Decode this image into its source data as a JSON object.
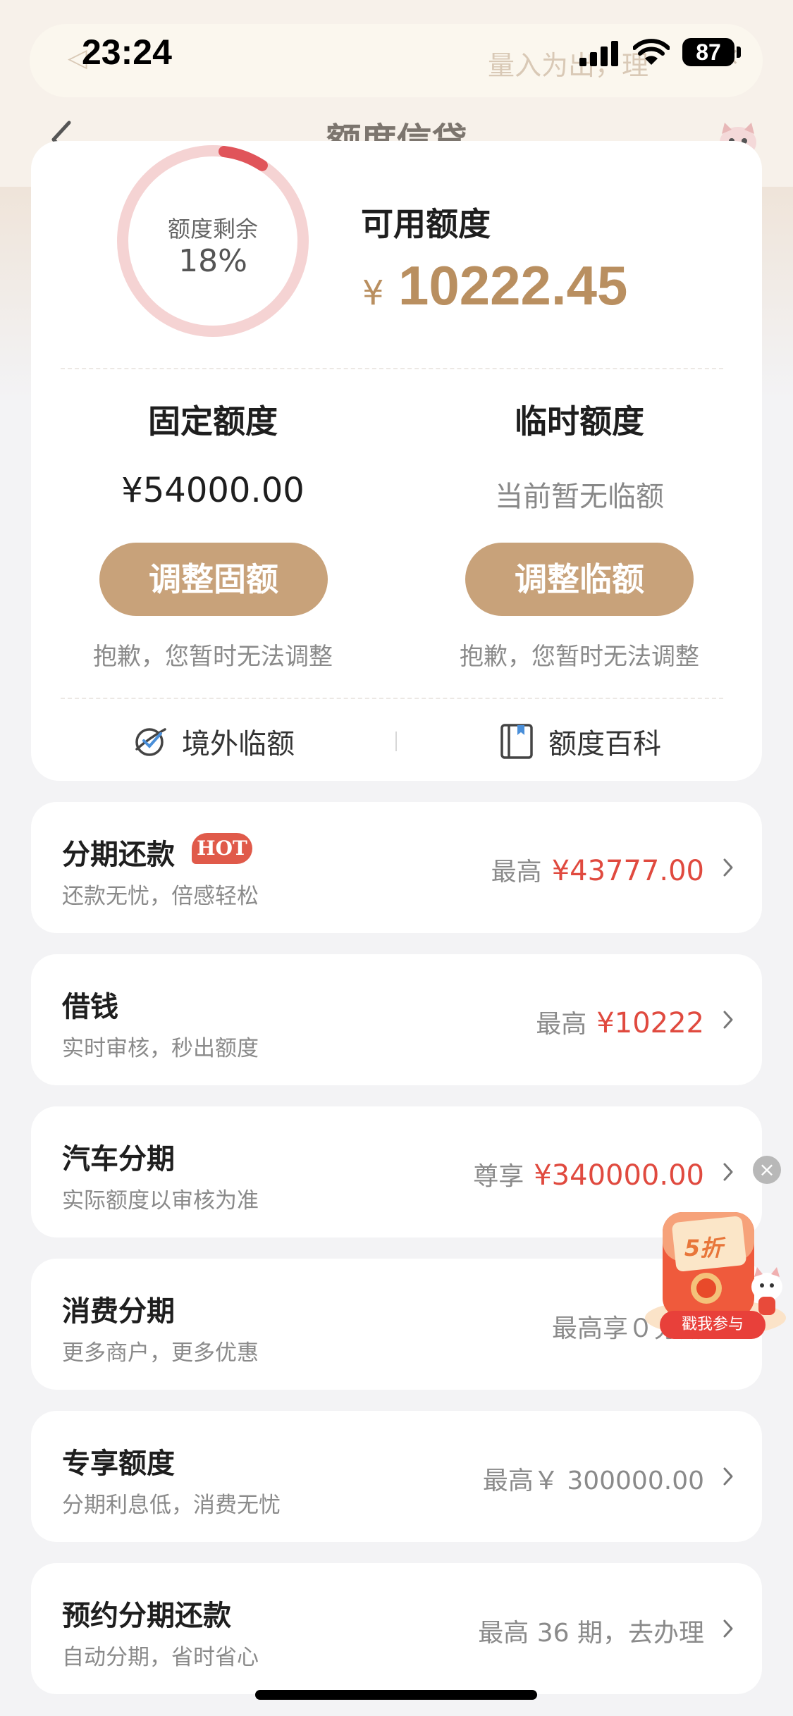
{
  "status_bar": {
    "time": "23:24",
    "battery": "87",
    "notice_text": "量入为出，理"
  },
  "nav": {
    "title": "额度信贷"
  },
  "summary": {
    "ring_label": "额度剩余",
    "ring_percent": "18%",
    "ring_fraction": 0.18,
    "available_label": "可用额度",
    "currency": "¥",
    "available_amount": "10222.45"
  },
  "fixed": {
    "title": "固定额度",
    "value": "¥54000.00",
    "button": "调整固额",
    "note": "抱歉，您暂时无法调整"
  },
  "temp": {
    "title": "临时额度",
    "value": "当前暂无临额",
    "button": "调整临额",
    "note": "抱歉，您暂时无法调整"
  },
  "quick_links": {
    "overseas": "境外临额",
    "encyclopedia": "额度百科"
  },
  "list": [
    {
      "title": "分期还款",
      "badge": "HOT",
      "subtitle": "还款无忧，倍感轻松",
      "prefix": "最高",
      "amount": "¥43777.00"
    },
    {
      "title": "借钱",
      "subtitle": "实时审核，秒出额度",
      "prefix": "最高",
      "amount": "¥10222"
    },
    {
      "title": "汽车分期",
      "subtitle": "实际额度以审核为准",
      "prefix": "尊享",
      "amount": "¥340000.00"
    },
    {
      "title": "消费分期",
      "subtitle": "更多商户，更多优惠",
      "right_text": "最高享０分期"
    },
    {
      "title": "专享额度",
      "subtitle": "分期利息低，消费无忧",
      "right_text": "最高￥ 300000.00"
    },
    {
      "title": "预约分期还款",
      "subtitle": "自动分期，省时省心",
      "right_text": "最高 36 期，去办理"
    }
  ],
  "promo": {
    "discount": "5折",
    "button": "戳我参与"
  },
  "colors": {
    "accent_gold": "#c8a27a",
    "amount_gold": "#b98f60",
    "amount_red": "#e04a3f",
    "ring_light": "#f5d3d3",
    "ring_dark": "#e0545a"
  }
}
